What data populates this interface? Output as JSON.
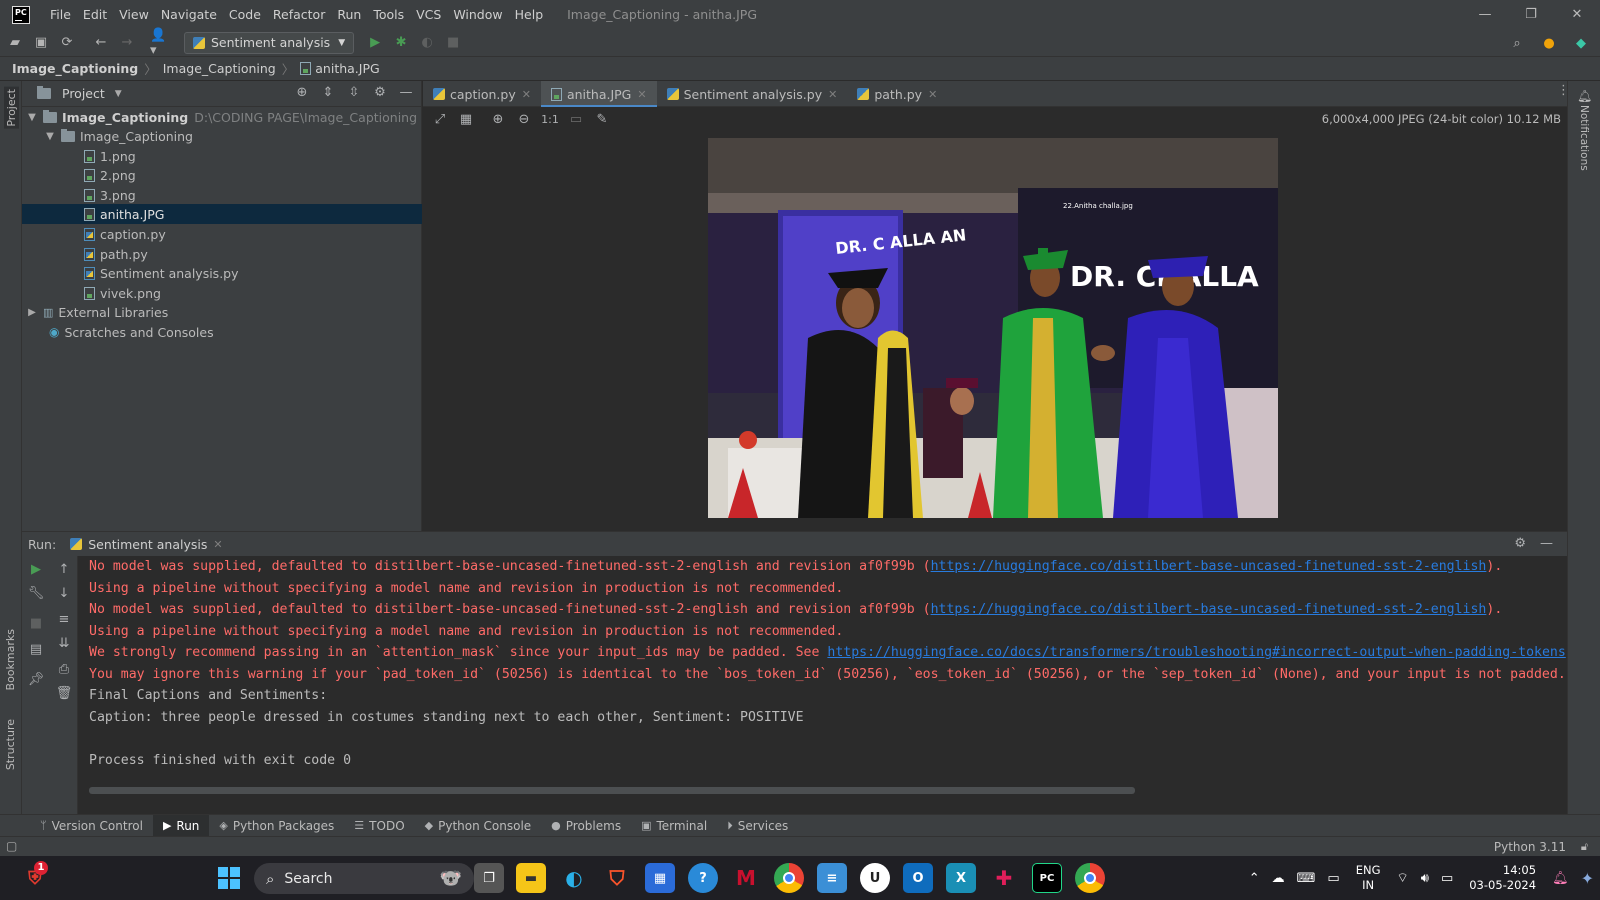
{
  "window": {
    "title": "Image_Captioning - anitha.JPG",
    "app_logo": "PC",
    "controls": [
      "—",
      "❐",
      "✕"
    ]
  },
  "menu": [
    "File",
    "Edit",
    "View",
    "Navigate",
    "Code",
    "Refactor",
    "Run",
    "Tools",
    "VCS",
    "Window",
    "Help"
  ],
  "toolbar": {
    "run_config": "Sentiment analysis"
  },
  "breadcrumbs": [
    "Image_Captioning",
    "Image_Captioning",
    "anitha.JPG"
  ],
  "left_stripe": {
    "project_label": "Project",
    "bookmarks_label": "Bookmarks",
    "structure_label": "Structure"
  },
  "project_panel": {
    "title": "Project",
    "tree": [
      {
        "label": "Image_Captioning",
        "path": "D:\\CODING PAGE\\Image_Captioning",
        "kind": "root"
      },
      {
        "label": "Image_Captioning",
        "kind": "folder"
      },
      {
        "label": "1.png",
        "kind": "image"
      },
      {
        "label": "2.png",
        "kind": "image"
      },
      {
        "label": "3.png",
        "kind": "image"
      },
      {
        "label": "anitha.JPG",
        "kind": "image"
      },
      {
        "label": "caption.py",
        "kind": "python"
      },
      {
        "label": "path.py",
        "kind": "python"
      },
      {
        "label": "Sentiment analysis.py",
        "kind": "python"
      },
      {
        "label": "vivek.png",
        "kind": "image"
      },
      {
        "label": "External Libraries",
        "kind": "library"
      },
      {
        "label": "Scratches and Consoles",
        "kind": "scratch"
      }
    ],
    "selected_index": 5
  },
  "editor_tabs": [
    {
      "label": "caption.py",
      "kind": "python"
    },
    {
      "label": "anitha.JPG",
      "kind": "image",
      "active": true
    },
    {
      "label": "Sentiment analysis.py",
      "kind": "python"
    },
    {
      "label": "path.py",
      "kind": "python"
    }
  ],
  "image_editor": {
    "info": "6,000x4,000 JPEG (24-bit color) 10.12 MB",
    "zoom_label": "1:1",
    "photo_screen_text": "22.Anitha challa.jpg",
    "photo_banner_text": "DR. CHALLA",
    "photo_sign_text": "DR. C ALLA AN"
  },
  "right_stripe": {
    "notifications_label": "Notifications"
  },
  "run_panel": {
    "label": "Run:",
    "tab": "Sentiment analysis",
    "lines": [
      {
        "type": "err",
        "text": "No model was supplied, defaulted to distilbert-base-uncased-finetuned-sst-2-english and revision af0f99b (",
        "link": "https://huggingface.co/distilbert-base-uncased-finetuned-sst-2-english",
        "after": ")."
      },
      {
        "type": "err",
        "text": "Using a pipeline without specifying a model name and revision in production is not recommended."
      },
      {
        "type": "err",
        "text": "No model was supplied, defaulted to distilbert-base-uncased-finetuned-sst-2-english and revision af0f99b (",
        "link": "https://huggingface.co/distilbert-base-uncased-finetuned-sst-2-english",
        "after": ")."
      },
      {
        "type": "err",
        "text": "Using a pipeline without specifying a model name and revision in production is not recommended."
      },
      {
        "type": "err",
        "text": "We strongly recommend passing in an `attention_mask` since your input_ids may be padded. See ",
        "link": "https://huggingface.co/docs/transformers/troubleshooting#incorrect-output-when-padding-tokens",
        "after": ""
      },
      {
        "type": "err",
        "text": "You may ignore this warning if your `pad_token_id` (50256) is identical to the `bos_token_id` (50256), `eos_token_id` (50256), or the `sep_token_id` (None), and your input is not padded."
      },
      {
        "type": "out",
        "text": "Final Captions and Sentiments:"
      },
      {
        "type": "out",
        "text": "Caption: three people dressed in costumes standing next to each other, Sentiment: POSITIVE"
      },
      {
        "type": "out",
        "text": ""
      },
      {
        "type": "out",
        "text": "Process finished with exit code 0"
      }
    ]
  },
  "tool_tabs": [
    {
      "label": "Version Control",
      "icon": "branch-icon"
    },
    {
      "label": "Run",
      "icon": "run-icon",
      "active": true
    },
    {
      "label": "Python Packages",
      "icon": "packages-icon"
    },
    {
      "label": "TODO",
      "icon": "list-icon"
    },
    {
      "label": "Python Console",
      "icon": "python-icon"
    },
    {
      "label": "Problems",
      "icon": "problems-icon"
    },
    {
      "label": "Terminal",
      "icon": "terminal-icon"
    },
    {
      "label": "Services",
      "icon": "services-icon"
    }
  ],
  "status_bar": {
    "interpreter": "Python 3.11"
  },
  "taskbar": {
    "notification_badge": "1",
    "search_placeholder": "Search",
    "lang_top": "ENG",
    "lang_bottom": "IN",
    "time": "14:05",
    "date": "03-05-2024"
  },
  "colors": {
    "error_text": "#ff6b68",
    "link": "#287bde",
    "selection": "#0d293e",
    "active_tab_underline": "#4a88c7",
    "run_green": "#499c54"
  }
}
